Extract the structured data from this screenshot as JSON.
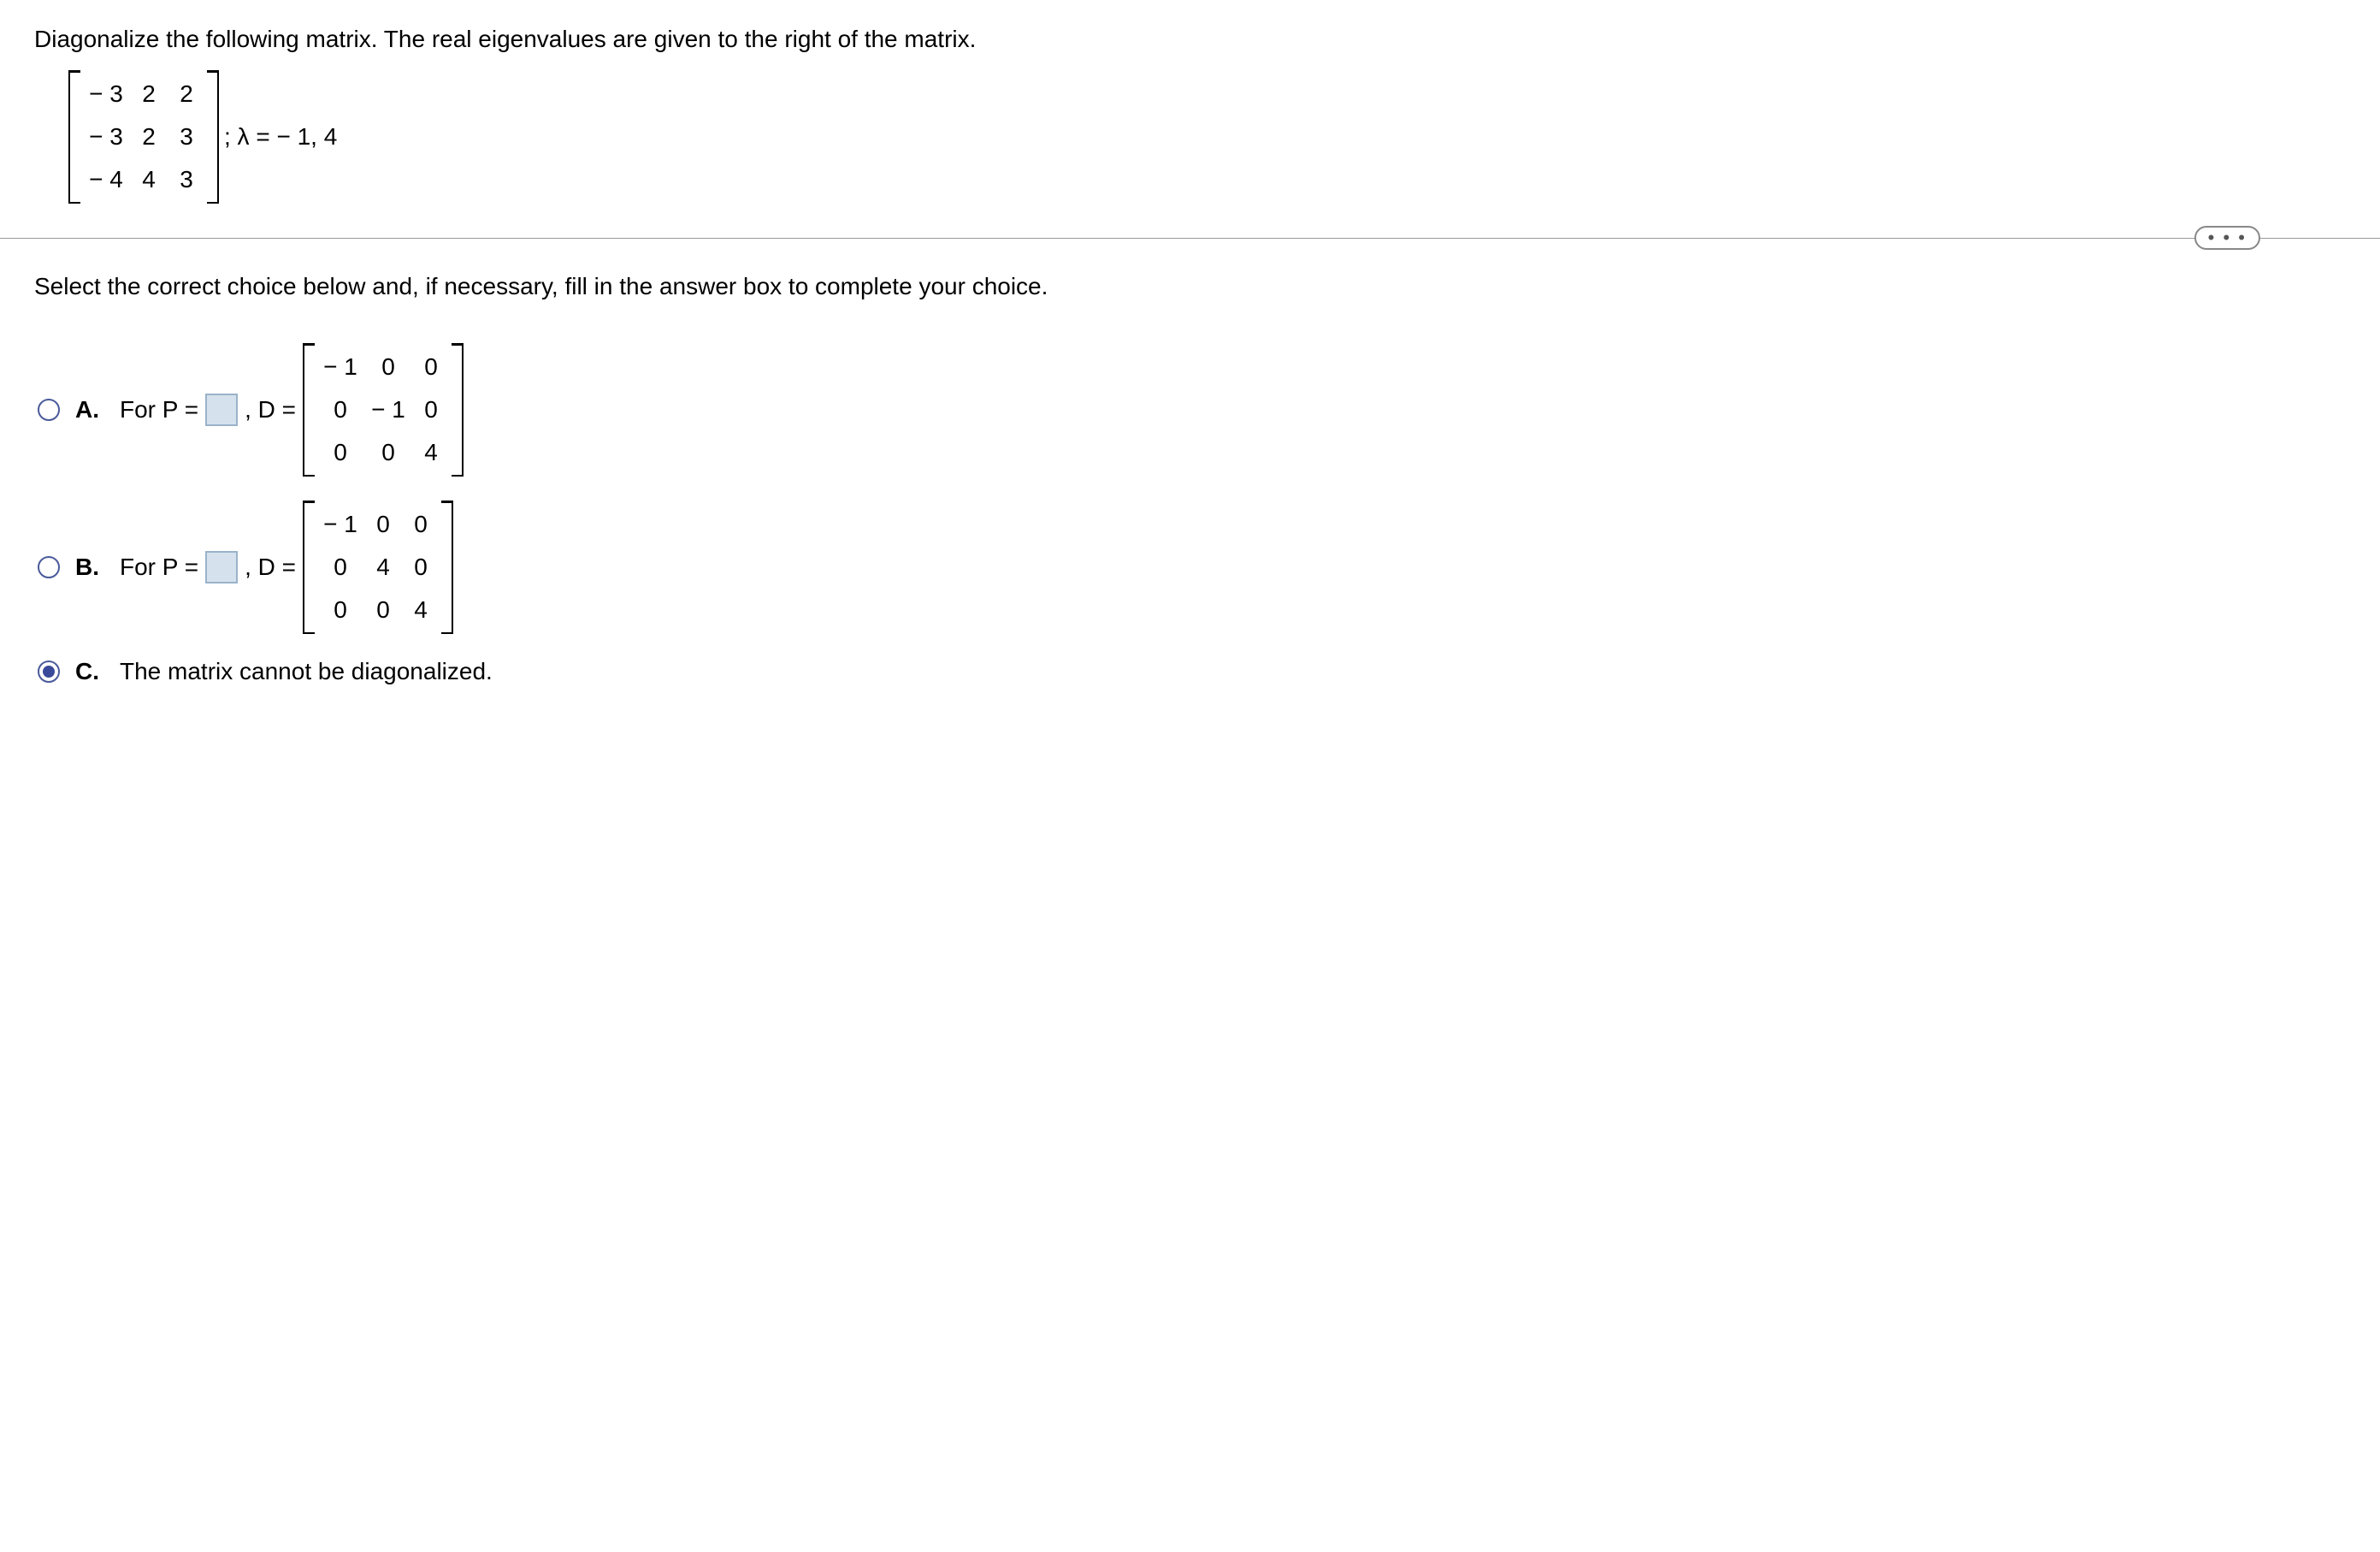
{
  "prompt": "Diagonalize the following matrix. The real eigenvalues are given to the right of the matrix.",
  "problem_matrix": {
    "rows": [
      [
        "− 3",
        "2",
        "2"
      ],
      [
        "− 3",
        "2",
        "3"
      ],
      [
        "− 4",
        "4",
        "3"
      ]
    ]
  },
  "eigen_text": "; λ = − 1, 4",
  "instruction": "Select the correct choice below and, if necessary, fill in the answer box to complete your choice.",
  "ellipsis": "• • •",
  "choices": {
    "a": {
      "label": "A.",
      "for_p": "For P =",
      "d_equals": ", D =",
      "matrix": {
        "rows": [
          [
            "− 1",
            "0",
            "0"
          ],
          [
            "0",
            "− 1",
            "0"
          ],
          [
            "0",
            "0",
            "4"
          ]
        ]
      }
    },
    "b": {
      "label": "B.",
      "for_p": "For P =",
      "d_equals": ", D =",
      "matrix": {
        "rows": [
          [
            "− 1",
            "0",
            "0"
          ],
          [
            "0",
            "4",
            "0"
          ],
          [
            "0",
            "0",
            "4"
          ]
        ]
      }
    },
    "c": {
      "label": "C.",
      "text": "The matrix cannot be diagonalized."
    }
  }
}
